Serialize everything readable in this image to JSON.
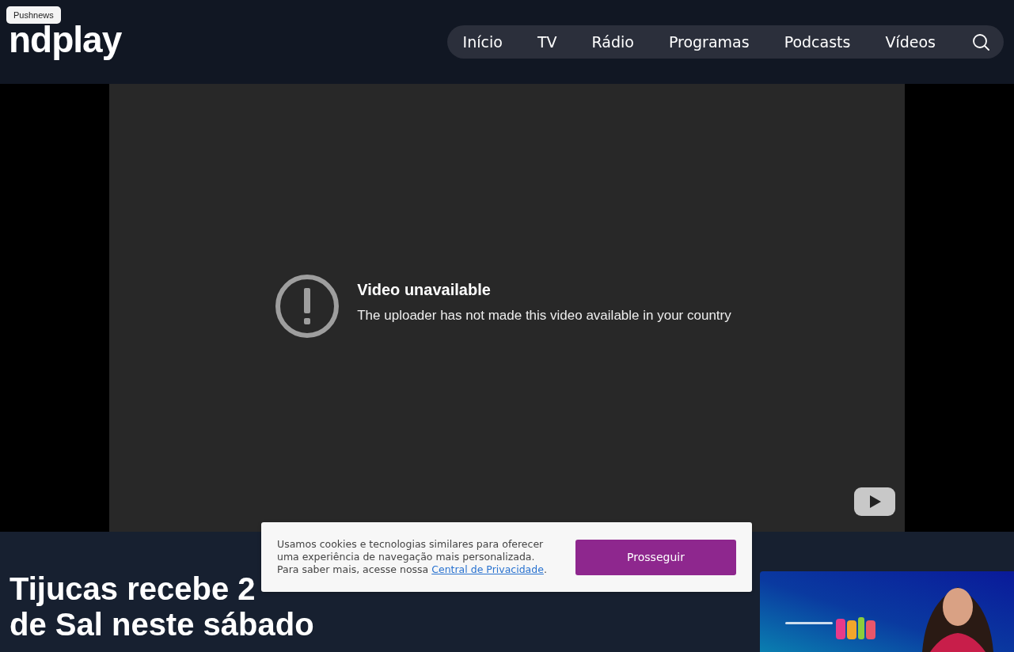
{
  "badge": {
    "label": "Pushnews"
  },
  "logo": {
    "text": "ndplay"
  },
  "nav": {
    "items": [
      {
        "label": "Início"
      },
      {
        "label": "TV"
      },
      {
        "label": "Rádio"
      },
      {
        "label": "Programas"
      },
      {
        "label": "Podcasts"
      },
      {
        "label": "Vídeos"
      }
    ]
  },
  "player": {
    "title": "Video unavailable",
    "message": "The uploader has not made this video available in your country"
  },
  "article": {
    "title_lines": [
      "Tijucas recebe 2",
      "de Sal neste sábado"
    ]
  },
  "cookie_notice": {
    "text": "Usamos cookies e tecnologias similares para oferecer uma experiência de navegação mais personalizada. Para saber mais, acesse nossa ",
    "link": "Central de Privacidade",
    "after": ".",
    "button": "Prosseguir"
  }
}
